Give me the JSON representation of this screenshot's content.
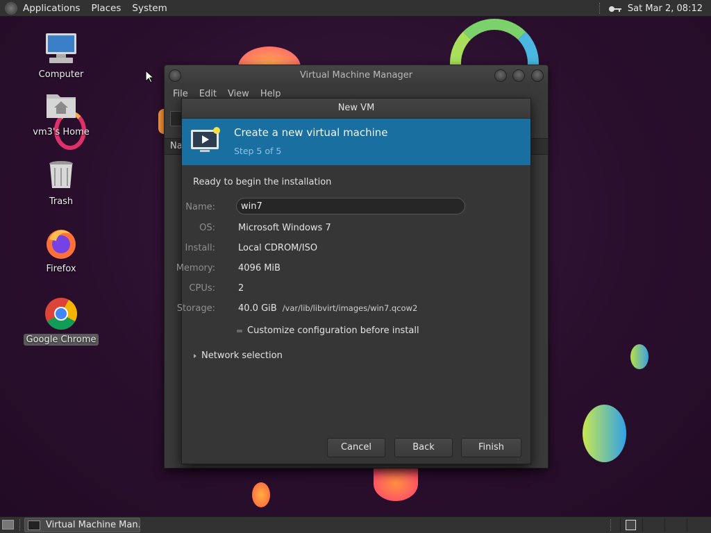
{
  "top_panel": {
    "menus": [
      "Applications",
      "Places",
      "System"
    ],
    "clock": "Sat Mar  2, 08:12"
  },
  "desktop_icons": [
    {
      "label": "Computer",
      "icon": "computer-icon"
    },
    {
      "label": "vm3's Home",
      "icon": "home-folder-icon"
    },
    {
      "label": "Trash",
      "icon": "trash-icon"
    },
    {
      "label": "Firefox",
      "icon": "firefox-icon"
    },
    {
      "label": "Google Chrome",
      "icon": "chrome-icon"
    }
  ],
  "vmm_window": {
    "title": "Virtual Machine Manager",
    "menus": [
      "File",
      "Edit",
      "View",
      "Help"
    ],
    "column_partial": "Na"
  },
  "dialog": {
    "title": "New VM",
    "header_title": "Create a new virtual machine",
    "header_step": "Step 5 of 5",
    "ready_text": "Ready to begin the installation",
    "name_label": "Name:",
    "name_value": "win7",
    "os_label": "OS:",
    "os_value": "Microsoft Windows 7",
    "install_label": "Install:",
    "install_value": "Local CDROM/ISO",
    "memory_label": "Memory:",
    "memory_value": "4096 MiB",
    "cpus_label": "CPUs:",
    "cpus_value": "2",
    "storage_label": "Storage:",
    "storage_value": "40.0 GiB",
    "storage_path": "/var/lib/libvirt/images/win7.qcow2",
    "customize_label": "Customize configuration before install",
    "customize_checked": false,
    "network_label": "Network selection",
    "buttons": {
      "cancel": "Cancel",
      "back": "Back",
      "finish": "Finish"
    }
  },
  "taskbar": {
    "task_label": "Virtual Machine Man..."
  },
  "colors": {
    "banner": "#1a6fa1",
    "panel": "#323232",
    "dialog_bg": "#363636"
  }
}
